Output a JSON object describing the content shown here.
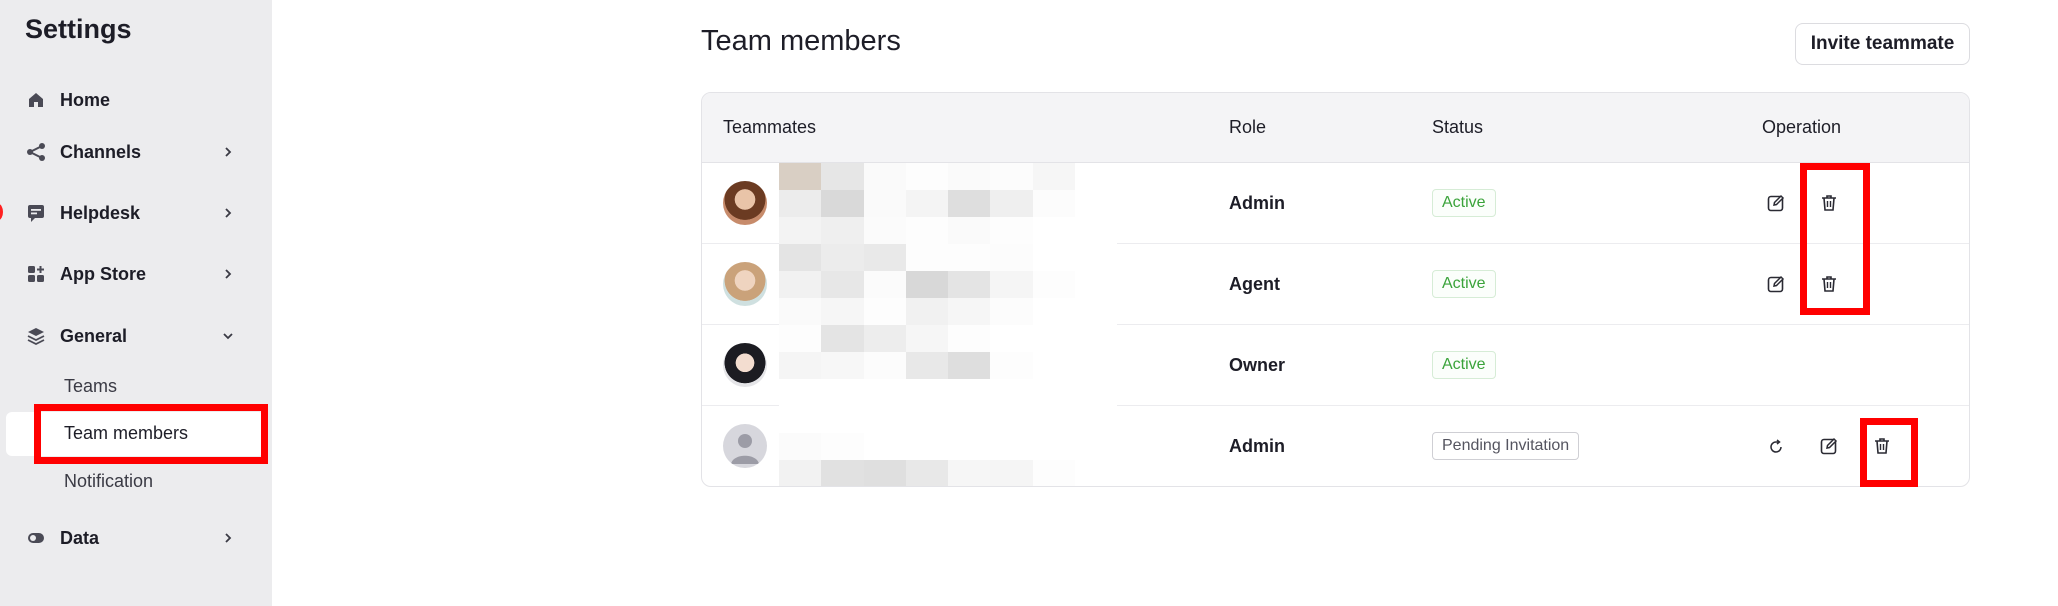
{
  "sidebar": {
    "title": "Settings",
    "items": [
      {
        "label": "Home",
        "icon": "home-icon"
      },
      {
        "label": "Channels",
        "icon": "share-icon"
      },
      {
        "label": "Helpdesk",
        "icon": "helpdesk-icon"
      },
      {
        "label": "App Store",
        "icon": "app-store-icon"
      },
      {
        "label": "General",
        "icon": "layers-icon"
      },
      {
        "label": "Data",
        "icon": "data-icon"
      }
    ],
    "general_sub": [
      {
        "label": "Teams"
      },
      {
        "label": "Team members"
      },
      {
        "label": "Notification"
      }
    ]
  },
  "page": {
    "title": "Team members",
    "invite_label": "Invite teammate"
  },
  "table": {
    "headers": [
      "Teammates",
      "Role",
      "Status",
      "Operation"
    ],
    "rows": [
      {
        "role": "Admin",
        "status": "Active",
        "status_type": "active",
        "ops": [
          "edit",
          "delete"
        ]
      },
      {
        "role": "Agent",
        "status": "Active",
        "status_type": "active",
        "ops": [
          "edit",
          "delete"
        ]
      },
      {
        "role": "Owner",
        "status": "Active",
        "status_type": "active",
        "ops": []
      },
      {
        "role": "Admin",
        "status": "Pending Invitation",
        "status_type": "pending",
        "ops": [
          "resend",
          "edit",
          "delete"
        ]
      }
    ]
  },
  "colors": {
    "sidebar_bg": "#ececee",
    "active_status": "#3aa33a",
    "highlight": "#ff0000"
  }
}
